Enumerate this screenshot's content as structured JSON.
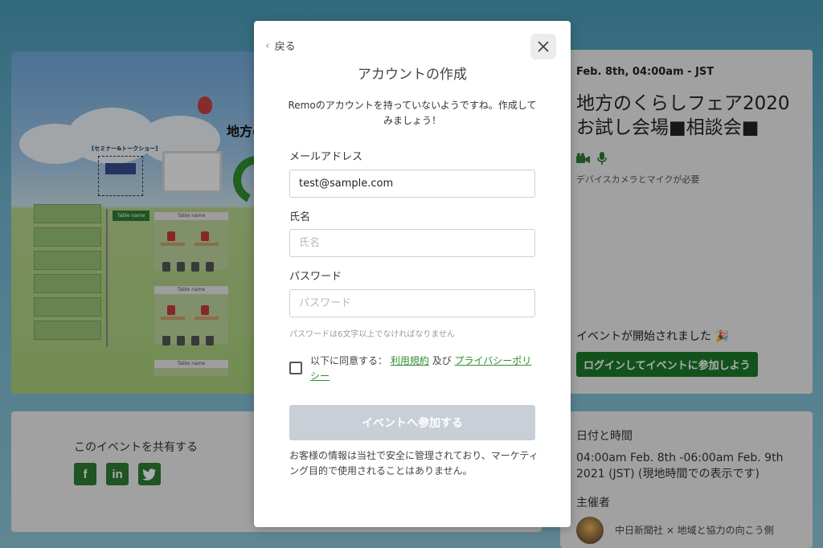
{
  "background": {
    "event_image": {
      "banner_title": "地方の",
      "stage_label": "[セミナー&トークショー]",
      "table_label": "Table name",
      "table_name": "Table name"
    },
    "info": {
      "date": "Feb. 8th, 04:00am - JST",
      "title": "地方のくらしフェア2020お試し会場■相談会■",
      "device_note": "デバイスカメラとマイクが必要",
      "started_text": "イベントが開始されました 🎉",
      "login_button": "ログインしてイベントに参加しよう"
    },
    "share": {
      "title": "このイベントを共有する",
      "icons": [
        "facebook-icon",
        "linkedin-icon",
        "twitter-icon"
      ]
    },
    "date_time": {
      "heading": "日付と時間",
      "value": "04:00am Feb. 8th -06:00am Feb. 9th 2021 (JST) (現地時間での表示です)",
      "organizer_heading": "主催者",
      "organizer_name": "中日新聞社 × 地域と協力の向こう側"
    }
  },
  "modal": {
    "back_label": "戻る",
    "title": "アカウントの作成",
    "subtitle": "Remoのアカウントを持っていないようですね。作成してみましょう！",
    "email": {
      "label": "メールアドレス",
      "value": "test@sample.com"
    },
    "name": {
      "label": "氏名",
      "placeholder": "氏名"
    },
    "password": {
      "label": "パスワード",
      "placeholder": "パスワード",
      "hint": "パスワードは6文字以上でなければなりません"
    },
    "agree": {
      "prefix": "以下に同意する：",
      "terms": "利用規約",
      "and": "及び",
      "privacy": "プライバシーポリシー"
    },
    "join_button": "イベントへ参加する",
    "privacy_note": "お客様の情報は当社で安全に管理されており、マーケティング目的で使用されることはありません。"
  },
  "colors": {
    "accent": "#2f7d34",
    "button_disabled": "#c8cfd7"
  }
}
